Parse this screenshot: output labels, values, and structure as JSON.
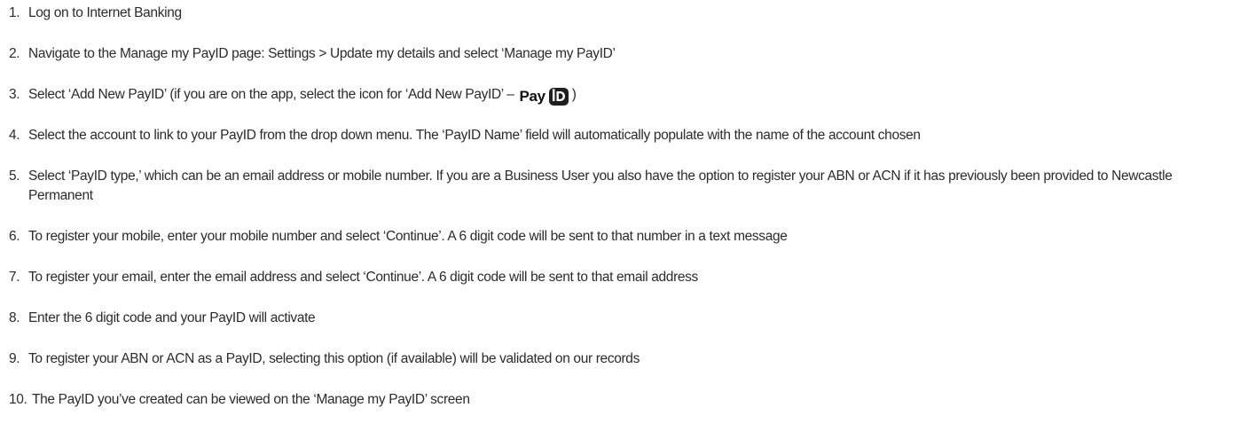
{
  "steps": [
    {
      "number": "1.",
      "text": "Log on to Internet Banking"
    },
    {
      "number": "2.",
      "text": "Navigate to the Manage my PayID page: Settings > Update my details and select ‘Manage my PayID’"
    },
    {
      "number": "3.",
      "text": "Select ‘Add New PayID’ (if you are on the app, select the icon for ‘Add New PayID’ –",
      "logo_text": "Pay",
      "suffix": ")"
    },
    {
      "number": "4.",
      "text": "Select the account to link to your PayID from the drop down menu. The ‘PayID Name’ field will automatically populate with the name of the account chosen"
    },
    {
      "number": "5.",
      "text": "Select ‘PayID type,’ which can be an email address or mobile number. If you are a Business User you also have the option to register your ABN or ACN if it has previously been provided to Newcastle Permanent"
    },
    {
      "number": "6.",
      "text": "To register your mobile, enter your mobile number and select ‘Continue’. A 6 digit code will be sent to that number in a text message"
    },
    {
      "number": "7.",
      "text": "To register your email, enter the email address and select ‘Continue’. A 6 digit code will be sent to that email address"
    },
    {
      "number": "8.",
      "text": "Enter the 6 digit code and your PayID will activate"
    },
    {
      "number": "9.",
      "text": "To register your ABN or ACN as a PayID, selecting this option (if available) will be validated on our records"
    },
    {
      "number": "10.",
      "text": "The PayID you’ve created can be viewed on the ‘Manage my PayID’ screen"
    }
  ],
  "payid_icon": "payid-logo-icon"
}
